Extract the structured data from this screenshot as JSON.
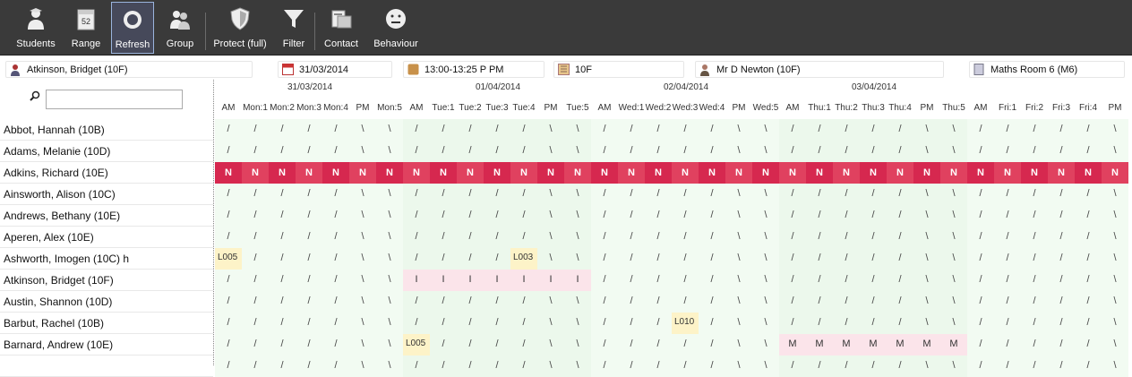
{
  "toolbar": {
    "buttons": [
      {
        "label": "Students",
        "icon": "student-icon"
      },
      {
        "label": "Range",
        "icon": "calendar-range-icon",
        "badge": "52"
      },
      {
        "label": "Refresh",
        "icon": "refresh-icon"
      },
      {
        "label": "Group",
        "icon": "group-icon"
      },
      {
        "label": "Protect (full)",
        "icon": "shield-icon"
      },
      {
        "label": "Filter",
        "icon": "filter-icon"
      },
      {
        "label": "Contact",
        "icon": "contact-icon"
      },
      {
        "label": "Behaviour",
        "icon": "behaviour-face-icon"
      }
    ]
  },
  "info": {
    "student": "Atkinson, Bridget (10F)",
    "date": "31/03/2014",
    "time": "13:00-13:25 P PM",
    "group": "10F",
    "teacher": "Mr D Newton (10F)",
    "room": "Maths Room 6 (M6)"
  },
  "search": {
    "value": "",
    "placeholder": ""
  },
  "dates": [
    "31/03/2014",
    "01/04/2014",
    "02/04/2014",
    "03/04/2014"
  ],
  "periods": [
    "AM",
    "Mon:1",
    "Mon:2",
    "Mon:3",
    "Mon:4",
    "PM",
    "Mon:5",
    "AM",
    "Tue:1",
    "Tue:2",
    "Tue:3",
    "Tue:4",
    "PM",
    "Tue:5",
    "AM",
    "Wed:1",
    "Wed:2",
    "Wed:3",
    "Wed:4",
    "PM",
    "Wed:5",
    "AM",
    "Thu:1",
    "Thu:2",
    "Thu:3",
    "Thu:4",
    "PM",
    "Thu:5",
    "AM",
    "Fri:1",
    "Fri:2",
    "Fri:3",
    "Fri:4",
    "PM"
  ],
  "students": [
    {
      "name": "Abbot, Hannah (10B)"
    },
    {
      "name": "Adams, Melanie (10D)"
    },
    {
      "name": "Adkins, Richard (10E)"
    },
    {
      "name": "Ainsworth, Alison (10C)"
    },
    {
      "name": "Andrews, Bethany (10E)"
    },
    {
      "name": "Aperen, Alex (10E)"
    },
    {
      "name": "Ashworth, Imogen (10C) h"
    },
    {
      "name": "Atkinson, Bridget (10F)"
    },
    {
      "name": "Austin, Shannon (10D)"
    },
    {
      "name": "Barbut, Rachel (10B)"
    },
    {
      "name": "Barnard, Andrew (10E)"
    },
    {
      "name": ""
    }
  ],
  "marks": {
    "default_am": "/",
    "default_pm": "\\",
    "row_overrides": {
      "2": {
        "all": "N"
      },
      "6": {
        "0": "L005",
        "11": "L003"
      },
      "7": {
        "7": "I",
        "8": "I",
        "9": "I",
        "10": "I",
        "11": "I",
        "12": "I",
        "13": "I"
      },
      "9": {
        "17": "L010"
      },
      "10": {
        "7": "L005",
        "21": "M",
        "22": "M",
        "23": "M",
        "24": "M",
        "25": "M",
        "26": "M",
        "27": "M"
      }
    }
  },
  "colors": {
    "toolbar_bg": "#3a3a3a",
    "absent_red": "#d6284f",
    "late_yellow": "#fdf3c8",
    "present_green": "#f2fbf2",
    "pink": "#fbe4ea"
  }
}
